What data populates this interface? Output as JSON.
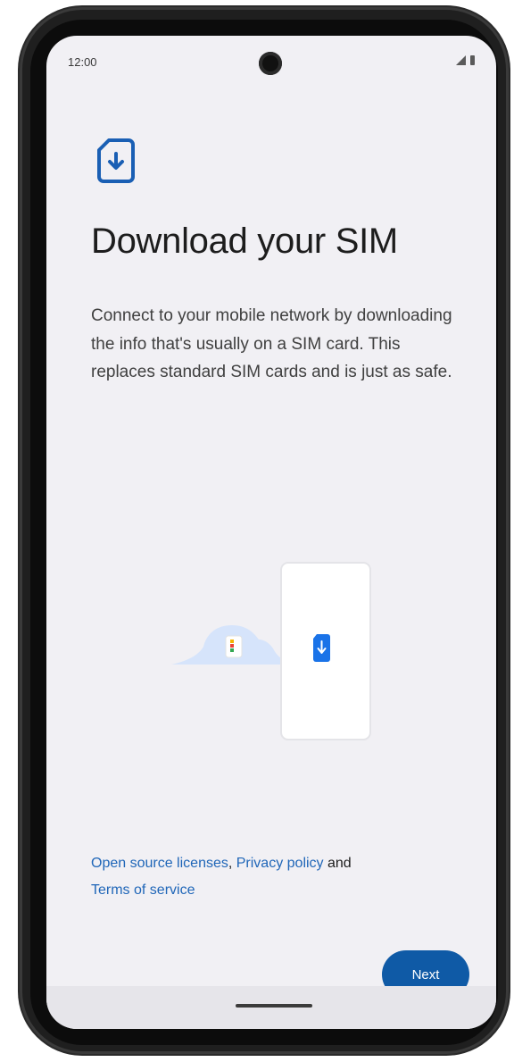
{
  "status_bar": {
    "time": "12:00"
  },
  "header": {
    "icon": "sim-download-icon",
    "title": "Download your SIM"
  },
  "body": {
    "description": "Connect to your mobile network by downloading the info that's usually on a SIM card. This replaces standard SIM cards and is just as safe."
  },
  "illustration": {
    "cloud_color": "#cfe0fb",
    "sim_color": "#1a73e8"
  },
  "legal": {
    "open_source_label": "Open source licenses",
    "separator": ", ",
    "privacy_label": "Privacy policy",
    "and_text": " and ",
    "terms_label": "Terms of service"
  },
  "actions": {
    "next_label": "Next"
  },
  "colors": {
    "accent": "#0f5aa6",
    "link": "#1f66b8",
    "background": "#f1f0f4"
  }
}
